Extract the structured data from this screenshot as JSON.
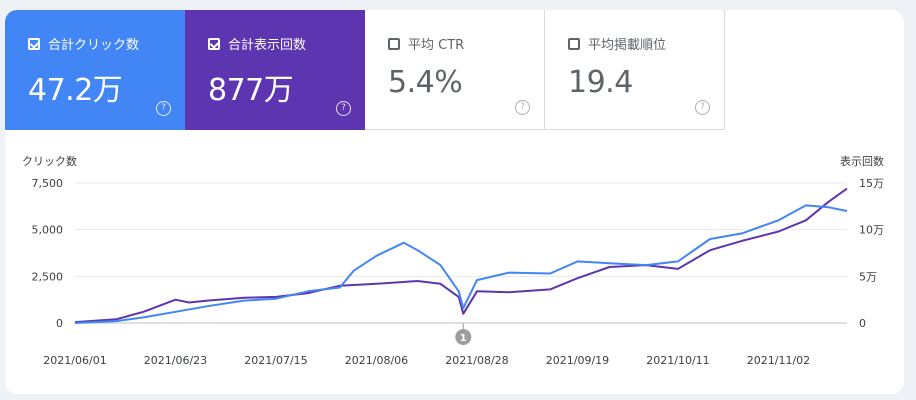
{
  "tiles": [
    {
      "label": "合計クリック数",
      "value": "47.2万",
      "checked": true
    },
    {
      "label": "合計表示回数",
      "value": "877万",
      "checked": true
    },
    {
      "label": "平均 CTR",
      "value": "5.4%",
      "checked": false
    },
    {
      "label": "平均掲載順位",
      "value": "19.4",
      "checked": false
    }
  ],
  "help_glyph": "?",
  "colors": {
    "clicks": "#4285f4",
    "impressions": "#5e35b1",
    "grid": "#e8eaed",
    "annotation": "#9e9e9e"
  },
  "chart_data": {
    "type": "line",
    "left_axis_title": "クリック数",
    "right_axis_title": "表示回数",
    "left_ticks": [
      "7,500",
      "5,000",
      "2,500",
      "0"
    ],
    "left_tick_values": [
      7500,
      5000,
      2500,
      0
    ],
    "right_ticks": [
      "15万",
      "10万",
      "5万",
      "0"
    ],
    "right_tick_values": [
      150000,
      100000,
      50000,
      0
    ],
    "ylim_left": [
      0,
      7500
    ],
    "ylim_right": [
      0,
      150000
    ],
    "x_tick_labels": [
      "2021/06/01",
      "2021/06/23",
      "2021/07/15",
      "2021/08/06",
      "2021/08/28",
      "2021/09/19",
      "2021/10/11",
      "2021/11/02"
    ],
    "x_start": "2021/06/01",
    "x_end": "2021/11/17",
    "annotation": {
      "label": "1",
      "date": "2021/08/25"
    },
    "series": [
      {
        "name": "クリック数",
        "axis": "left",
        "color": "#4285f4",
        "x": [
          "2021/06/01",
          "2021/06/10",
          "2021/06/16",
          "2021/06/23",
          "2021/06/30",
          "2021/07/08",
          "2021/07/15",
          "2021/07/22",
          "2021/07/29",
          "2021/08/01",
          "2021/08/06",
          "2021/08/12",
          "2021/08/15",
          "2021/08/20",
          "2021/08/24",
          "2021/08/25",
          "2021/08/28",
          "2021/09/04",
          "2021/09/13",
          "2021/09/19",
          "2021/09/26",
          "2021/10/04",
          "2021/10/11",
          "2021/10/18",
          "2021/10/25",
          "2021/11/02",
          "2021/11/08",
          "2021/11/13",
          "2021/11/17"
        ],
        "values": [
          0,
          100,
          300,
          600,
          900,
          1200,
          1300,
          1700,
          1900,
          2800,
          3600,
          4300,
          3900,
          3100,
          1700,
          800,
          2300,
          2700,
          2650,
          3300,
          3200,
          3100,
          3300,
          4500,
          4800,
          5500,
          6300,
          6200,
          6000
        ]
      },
      {
        "name": "表示回数",
        "axis": "right",
        "color": "#5e35b1",
        "x": [
          "2021/06/01",
          "2021/06/10",
          "2021/06/16",
          "2021/06/23",
          "2021/06/26",
          "2021/06/30",
          "2021/07/08",
          "2021/07/15",
          "2021/07/22",
          "2021/07/29",
          "2021/08/06",
          "2021/08/15",
          "2021/08/20",
          "2021/08/24",
          "2021/08/25",
          "2021/08/28",
          "2021/09/04",
          "2021/09/13",
          "2021/09/19",
          "2021/09/26",
          "2021/10/04",
          "2021/10/11",
          "2021/10/18",
          "2021/10/25",
          "2021/11/02",
          "2021/11/08",
          "2021/11/13",
          "2021/11/17"
        ],
        "values": [
          1000,
          4000,
          12000,
          25000,
          22000,
          24000,
          27000,
          28000,
          32000,
          40000,
          42000,
          45000,
          42000,
          28000,
          10000,
          34000,
          33000,
          36000,
          48000,
          60000,
          62000,
          58000,
          78000,
          88000,
          98000,
          110000,
          130000,
          144000
        ]
      }
    ]
  }
}
